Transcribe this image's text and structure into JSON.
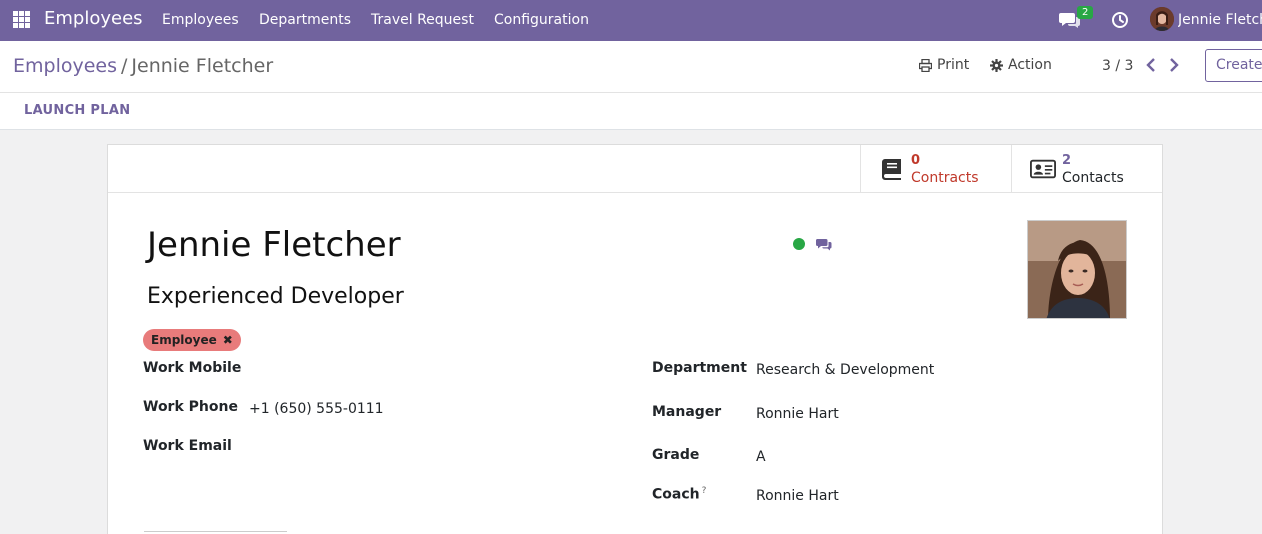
{
  "navbar": {
    "app_title": "Employees",
    "menu": [
      "Employees",
      "Departments",
      "Travel Request",
      "Configuration"
    ],
    "chat_badge": "2",
    "user_name": "Jennie Fletcher",
    "accent_color": "#71639e"
  },
  "control_panel": {
    "breadcrumb_parent": "Employees",
    "breadcrumb_separator": "/",
    "breadcrumb_current": "Jennie Fletcher",
    "print_label": "Print",
    "action_label": "Action",
    "pager": "3 / 3",
    "create_label": "Create"
  },
  "statusbar": {
    "launch_plan_label": "LAUNCH PLAN"
  },
  "smart_buttons": [
    {
      "value": "0",
      "label": "Contracts",
      "icon": "book-icon",
      "color": "#c0392b"
    },
    {
      "value": "2",
      "label": "Contacts",
      "icon": "id-card-icon",
      "color": "#71639e"
    }
  ],
  "employee": {
    "name": "Jennie Fletcher",
    "job_title": "Experienced Developer",
    "presence_color": "#28a745",
    "tag": "Employee",
    "tag_color": "#e87b7b"
  },
  "fields_left": [
    {
      "label": "Work Mobile",
      "value": ""
    },
    {
      "label": "Work Phone",
      "value": "+1 (650) 555-0111"
    },
    {
      "label": "Work Email",
      "value": ""
    }
  ],
  "fields_right": [
    {
      "label": "Department",
      "value": "Research & Development"
    },
    {
      "label": "Manager",
      "value": "Ronnie Hart"
    },
    {
      "label": "Grade",
      "value": "A"
    },
    {
      "label": "Coach",
      "value": "Ronnie Hart",
      "help": "?"
    }
  ]
}
